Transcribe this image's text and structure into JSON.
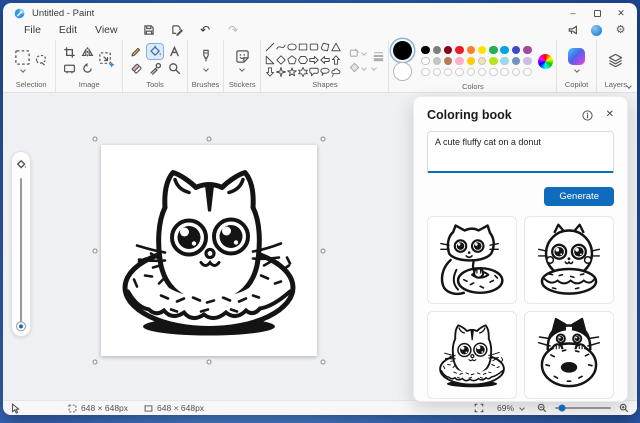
{
  "window": {
    "title": "Untitled - Paint",
    "icons": {
      "app": "paint-app-icon",
      "minimize": "minimize-icon",
      "maximize": "maximize-icon",
      "close": "close-icon"
    }
  },
  "menu_bar": {
    "menus": [
      {
        "label": "File"
      },
      {
        "label": "Edit"
      },
      {
        "label": "View"
      }
    ],
    "action_icons": [
      "save-icon",
      "save-as-icon",
      "undo-icon",
      "redo-icon"
    ],
    "right_icons": [
      "feedback-icon",
      "account-avatar",
      "settings-gear-icon"
    ]
  },
  "ribbon": {
    "groups": {
      "selection": {
        "label": "Selection",
        "icons": [
          "rectangular-selection-icon",
          "free-form-selection-icon",
          "dropdown-chevron-icon"
        ]
      },
      "image": {
        "label": "Image",
        "icons": [
          "crop-icon",
          "flip-icon",
          "rotate-icon",
          "resize-icon"
        ]
      },
      "tools": {
        "label": "Tools",
        "selected_tool": "fill",
        "icons": [
          "pencil-icon",
          "fill-icon",
          "text-tool-icon",
          "eraser-icon",
          "eyedropper-icon",
          "magnifier-icon"
        ]
      },
      "brushes": {
        "label": "Brushes",
        "icons": [
          "brush-icon",
          "dropdown-chevron-icon"
        ]
      },
      "stickers": {
        "label": "Stickers",
        "icons": [
          "sticker-icon",
          "dropdown-chevron-icon"
        ]
      },
      "shapes": {
        "label": "Shapes",
        "items": [
          "line",
          "curve",
          "oval",
          "rectangle",
          "rounded-rectangle",
          "polygon",
          "triangle",
          "right-triangle",
          "diamond",
          "pentagon",
          "hexagon",
          "right-arrow",
          "left-arrow",
          "up-arrow",
          "down-arrow",
          "four-point-star",
          "five-point-star",
          "six-point-star",
          "rounded-callout",
          "oval-callout",
          "cloud-callout",
          "heart",
          "lightning"
        ],
        "side_icons": [
          "shape-outline-icon",
          "shape-fill-icon",
          "line-size-icon"
        ]
      },
      "colors": {
        "label": "Colors",
        "color1": "#000000",
        "color2": "#ffffff",
        "palette": [
          [
            "#000000",
            "#7f7f7f",
            "#880015",
            "#ed1c24",
            "#ff7f27",
            "#ffe100",
            "#22b14c",
            "#00a2e8",
            "#3f48cc",
            "#a349a4"
          ],
          [
            "#ffffff",
            "#c3c3c3",
            "#b97a57",
            "#ffaec9",
            "#ffc90e",
            "#efe4b0",
            "#b5e61d",
            "#99d9ea",
            "#7092be",
            "#c8bfe7"
          ]
        ],
        "empty_slots": 10,
        "icons": [
          "edit-colors-wheel-icon"
        ]
      },
      "copilot": {
        "label": "Copilot",
        "icons": [
          "copilot-icon",
          "dropdown-chevron-icon"
        ]
      },
      "layers": {
        "label": "Layers",
        "icons": [
          "layers-icon"
        ]
      }
    }
  },
  "left_toolbar": {
    "icons": [
      "fill-tool-options-icon"
    ],
    "control": "size-slider"
  },
  "canvas": {
    "artwork": "cat-head-in-donut-line-art",
    "selection_handles": 8
  },
  "coloring_book_panel": {
    "title": "Coloring book",
    "icons": [
      "info-icon",
      "close-icon"
    ],
    "prompt_value": "A cute fluffy cat on a donut",
    "generate_label": "Generate",
    "thumbnails": [
      {
        "name": "cat-hugging-donut"
      },
      {
        "name": "fluffy-cat-on-donut"
      },
      {
        "name": "cat-head-in-donut"
      },
      {
        "name": "black-white-cat-behind-donut"
      }
    ]
  },
  "status_bar": {
    "icons": [
      "cursor-position-icon",
      "selection-size-icon",
      "canvas-size-icon",
      "fit-to-screen-icon",
      "zoom-out-icon",
      "zoom-in-icon"
    ],
    "selection_size": "648 × 648px",
    "canvas_size": "648 × 648px",
    "zoom_level": "69%"
  },
  "accent_colors": {
    "primary_button": "#0f6cbd",
    "focus_border": "#0f6cbd",
    "desktop_blue": "#2d62b8"
  }
}
